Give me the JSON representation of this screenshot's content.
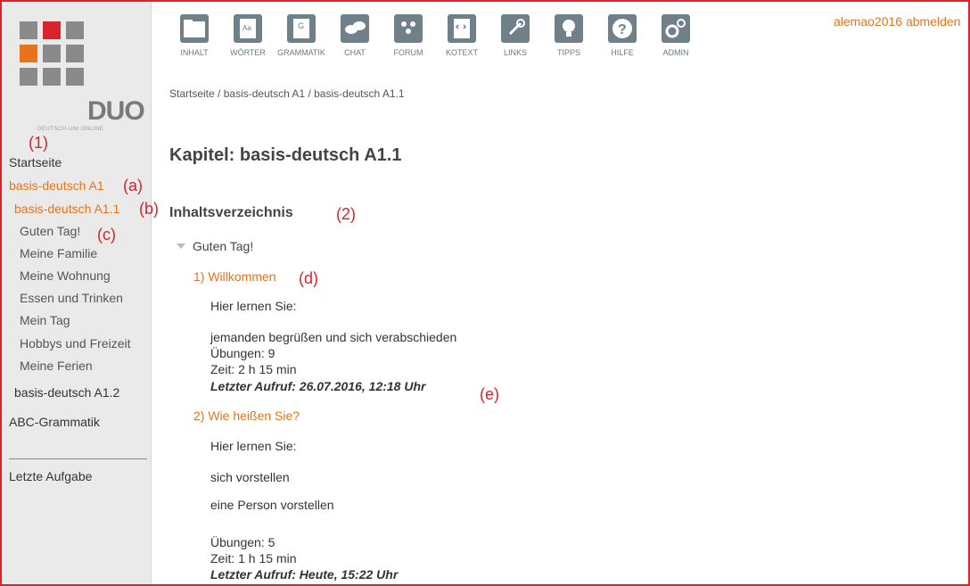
{
  "logo": {
    "text": "DUO",
    "subtitle": "DEUTSCH-UNI ONLINE",
    "accent_colors": [
      "#d9232d",
      "#e8731b"
    ]
  },
  "toolbar": [
    {
      "label": "INHALT",
      "icon": "folder-icon"
    },
    {
      "label": "WÖRTER",
      "icon": "dictionary-icon"
    },
    {
      "label": "GRAMMATIK",
      "icon": "grammar-book-icon"
    },
    {
      "label": "CHAT",
      "icon": "chat-icon"
    },
    {
      "label": "FORUM",
      "icon": "forum-icon"
    },
    {
      "label": "KOTEXT",
      "icon": "code-document-icon"
    },
    {
      "label": "LINKS",
      "icon": "link-icon"
    },
    {
      "label": "TIPPS",
      "icon": "lightbulb-icon"
    },
    {
      "label": "HILFE",
      "icon": "help-icon"
    },
    {
      "label": "ADMIN",
      "icon": "gears-icon"
    }
  ],
  "user": {
    "label": "alemao2016 abmelden"
  },
  "breadcrumb": [
    "Startseite",
    "basis-deutsch A1",
    "basis-deutsch A1.1"
  ],
  "sidebar": {
    "items": [
      {
        "label": "Startseite"
      },
      {
        "label": "basis-deutsch A1"
      },
      {
        "label": "basis-deutsch A1.1"
      },
      {
        "label": "Guten Tag!"
      },
      {
        "label": "Meine Familie"
      },
      {
        "label": "Meine Wohnung"
      },
      {
        "label": "Essen und Trinken"
      },
      {
        "label": "Mein Tag"
      },
      {
        "label": "Hobbys und Freizeit"
      },
      {
        "label": "Meine Ferien"
      },
      {
        "label": "basis-deutsch A1.2"
      },
      {
        "label": "ABC-Grammatik"
      }
    ],
    "bottom_item": "Letzte Aufgabe"
  },
  "annotations": [
    "(1)",
    "(a)",
    "(b)",
    "(c)",
    "(2)",
    "(d)",
    "(e)"
  ],
  "main": {
    "title": "Kapitel: basis-deutsch A1.1",
    "toc_heading": "Inhaltsverzeichnis",
    "chapter": "Guten Tag!",
    "lessons": [
      {
        "title": "1) Willkommen",
        "intro": "Hier lernen Sie:",
        "goals": [
          "jemanden begrüßen und sich verabschieden"
        ],
        "exercises": "Übungen: 9",
        "time": "Zeit: 2 h 15 min",
        "last_access": "Letzter Aufruf: 26.07.2016, 12:18 Uhr"
      },
      {
        "title": "2) Wie heißen Sie?",
        "intro": "Hier lernen Sie:",
        "goals": [
          "sich vorstellen",
          "eine Person vorstellen"
        ],
        "exercises": "Übungen: 5",
        "time": "Zeit: 1 h 15 min",
        "last_access": "Letzter Aufruf: Heute, 15:22 Uhr"
      }
    ]
  }
}
